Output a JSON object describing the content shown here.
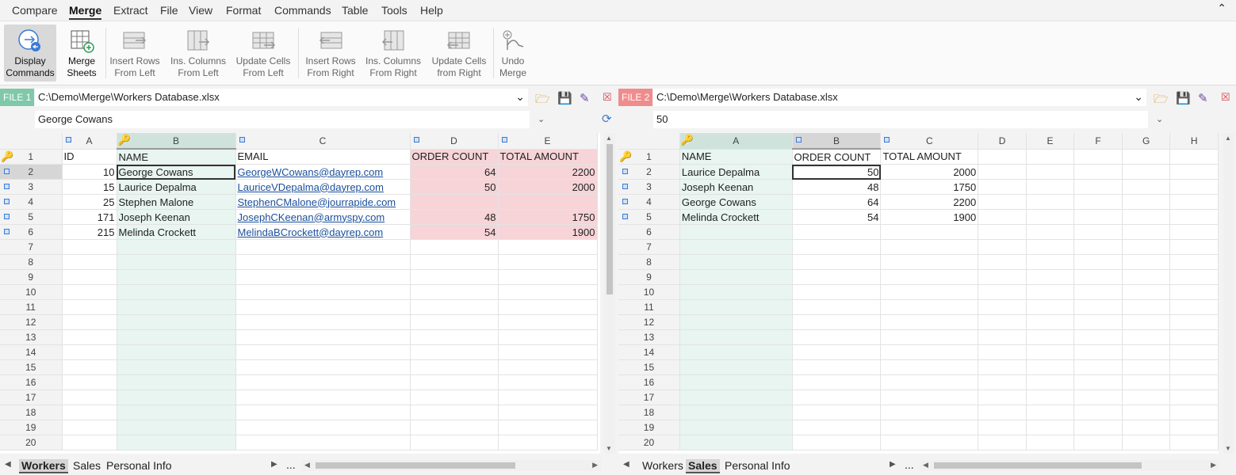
{
  "menu": {
    "items": [
      "Compare",
      "Merge",
      "Extract",
      "File",
      "View",
      "Format",
      "Commands",
      "Table",
      "Tools",
      "Help"
    ],
    "active": "Merge"
  },
  "ribbon": {
    "display_commands": [
      "Display",
      "Commands"
    ],
    "merge_sheets": [
      "Merge",
      "Sheets"
    ],
    "insert_rows_left": [
      "Insert Rows",
      "From Left"
    ],
    "ins_columns_left": [
      "Ins. Columns",
      "From Left"
    ],
    "update_cells_left": [
      "Update Cells",
      "From Left"
    ],
    "insert_rows_right": [
      "Insert Rows",
      "From Right"
    ],
    "ins_columns_right": [
      "Ins. Columns",
      "From Right"
    ],
    "update_cells_right": [
      "Update Cells",
      "from Right"
    ],
    "undo_merge": [
      "Undo",
      "Merge"
    ]
  },
  "left": {
    "file_tag": "FILE 1",
    "file_tag_color": "#7fc8a9",
    "path": "C:\\Demo\\Merge\\Workers Database.xlsx",
    "cell_value": "George Cowans",
    "columns": [
      "A",
      "B",
      "C",
      "D",
      "E"
    ],
    "rows": [
      [
        "ID",
        "NAME",
        "EMAIL",
        "ORDER COUNT",
        "TOTAL AMOUNT"
      ],
      [
        "10",
        "George Cowans",
        "GeorgeWCowans@dayrep.com",
        "64",
        "2200"
      ],
      [
        "15",
        "Laurice Depalma",
        "LauriceVDepalma@dayrep.com",
        "50",
        "2000"
      ],
      [
        "25",
        "Stephen Malone",
        "StephenCMalone@jourrapide.com",
        "",
        ""
      ],
      [
        "171",
        "Joseph Keenan",
        "JosephCKeenan@armyspy.com",
        "48",
        "1750"
      ],
      [
        "215",
        "Melinda Crockett",
        "MelindaBCrockett@dayrep.com",
        "54",
        "1900"
      ]
    ],
    "row_numbers": [
      "1",
      "2",
      "3",
      "4",
      "5",
      "6",
      "7",
      "8",
      "9",
      "10",
      "11",
      "12",
      "13",
      "14",
      "15",
      "16",
      "17",
      "18",
      "19",
      "20"
    ],
    "sheets": [
      "Workers",
      "Sales",
      "Personal Info"
    ],
    "active_sheet": "Workers",
    "ellipsis": "..."
  },
  "right": {
    "file_tag": "FILE 2",
    "file_tag_color": "#f08c8c",
    "path": "C:\\Demo\\Merge\\Workers Database.xlsx",
    "cell_value": "50",
    "columns": [
      "A",
      "B",
      "C",
      "D",
      "E",
      "F",
      "G",
      "H"
    ],
    "rows": [
      [
        "NAME",
        "ORDER COUNT",
        "TOTAL AMOUNT"
      ],
      [
        "Laurice Depalma",
        "50",
        "2000"
      ],
      [
        "Joseph Keenan",
        "48",
        "1750"
      ],
      [
        "George Cowans",
        "64",
        "2200"
      ],
      [
        "Melinda Crockett",
        "54",
        "1900"
      ]
    ],
    "row_numbers": [
      "1",
      "2",
      "3",
      "4",
      "5",
      "6",
      "7",
      "8",
      "9",
      "10",
      "11",
      "12",
      "13",
      "14",
      "15",
      "16",
      "17",
      "18",
      "19",
      "20"
    ],
    "sheets": [
      "Workers",
      "Sales",
      "Personal Info"
    ],
    "active_sheet": "Sales",
    "ellipsis": "..."
  },
  "icons": {
    "collapse": "chevron-up-icon",
    "dropdown": "chevron-down-icon",
    "expand": "expand-icon",
    "sync": "sync-icon",
    "open": "open-file-icon",
    "save": "save-icon",
    "save_as": "save-as-icon",
    "close": "close-icon",
    "key": "key-icon"
  }
}
